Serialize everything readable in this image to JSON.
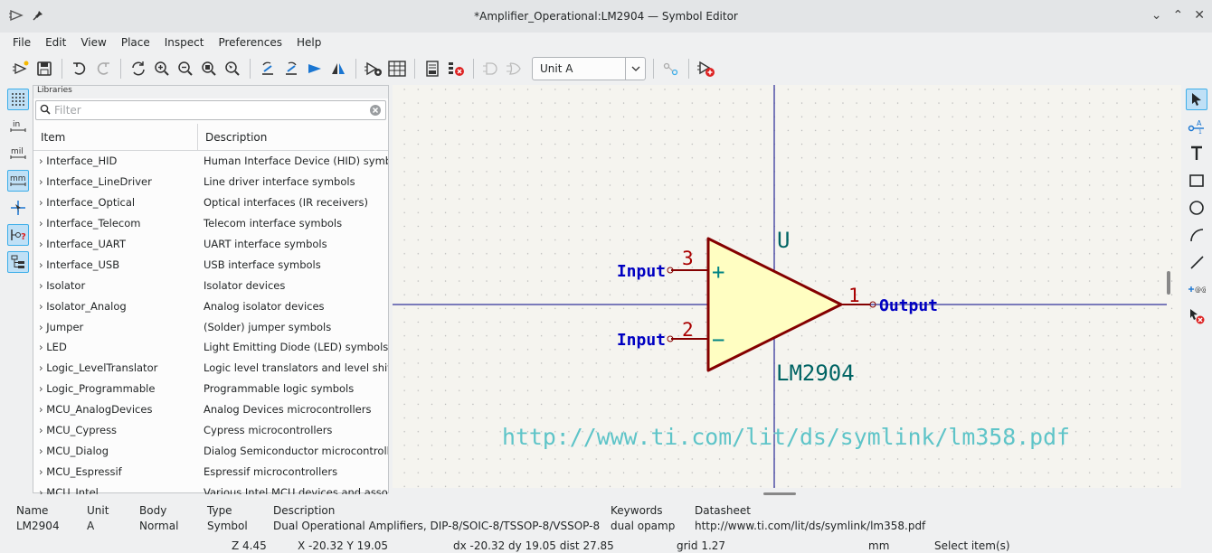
{
  "window": {
    "title": "*Amplifier_Operational:LM2904 — Symbol Editor"
  },
  "menu": [
    "File",
    "Edit",
    "View",
    "Place",
    "Inspect",
    "Preferences",
    "Help"
  ],
  "toolbar": {
    "unit_selected": "Unit A",
    "icons": [
      "new-symbol-icon",
      "save-icon",
      "undo-icon",
      "redo-icon",
      "refresh-icon",
      "zoom-in-icon",
      "zoom-out-icon",
      "zoom-fit-icon",
      "zoom-selection-icon",
      "rotate-ccw-icon",
      "rotate-cw-icon",
      "mirror-v-icon",
      "mirror-h-icon",
      "symbol-properties-icon",
      "pin-table-icon",
      "datasheet-icon",
      "check-icon",
      "de-morgan-standard-icon",
      "de-morgan-alternate-icon",
      "sync-pins-icon",
      "add-to-schematic-icon"
    ]
  },
  "left_tools": [
    "grid-icon",
    "inches-icon",
    "mils-icon",
    "millimeters-icon",
    "cursor-icon",
    "pin-type-icon",
    "hierarchy-icon"
  ],
  "libraries": {
    "panel_title": "Libraries",
    "search_placeholder": "Filter",
    "col_item": "Item",
    "col_description": "Description",
    "rows": [
      {
        "item": "Interface_HID",
        "desc": "Human Interface Device (HID) symbols"
      },
      {
        "item": "Interface_LineDriver",
        "desc": "Line driver interface symbols"
      },
      {
        "item": "Interface_Optical",
        "desc": "Optical interfaces (IR receivers)"
      },
      {
        "item": "Interface_Telecom",
        "desc": "Telecom interface symbols"
      },
      {
        "item": "Interface_UART",
        "desc": "UART interface symbols"
      },
      {
        "item": "Interface_USB",
        "desc": "USB interface symbols"
      },
      {
        "item": "Isolator",
        "desc": "Isolator devices"
      },
      {
        "item": "Isolator_Analog",
        "desc": "Analog isolator devices"
      },
      {
        "item": "Jumper",
        "desc": "(Solder) jumper symbols"
      },
      {
        "item": "LED",
        "desc": "Light Emitting Diode (LED) symbols"
      },
      {
        "item": "Logic_LevelTranslator",
        "desc": "Logic level translators and level shifters"
      },
      {
        "item": "Logic_Programmable",
        "desc": "Programmable logic symbols"
      },
      {
        "item": "MCU_AnalogDevices",
        "desc": "Analog Devices microcontrollers"
      },
      {
        "item": "MCU_Cypress",
        "desc": "Cypress microcontrollers"
      },
      {
        "item": "MCU_Dialog",
        "desc": "Dialog Semiconductor microcontrollers"
      },
      {
        "item": "MCU_Espressif",
        "desc": "Espressif microcontrollers"
      },
      {
        "item": "MCU_Intel",
        "desc": "Various Intel MCU devices and associated"
      }
    ]
  },
  "symbol": {
    "reference": "U",
    "value": "LM2904",
    "datasheet_url": "http://www.ti.com/lit/ds/symlink/lm358.pdf",
    "pins": [
      {
        "number": "3",
        "name": "Input",
        "sign": "+"
      },
      {
        "number": "2",
        "name": "Input",
        "sign": "−"
      },
      {
        "number": "1",
        "name": "Output",
        "sign": ""
      }
    ]
  },
  "right_tools": [
    "select-icon",
    "pin-icon",
    "text-icon",
    "rectangle-icon",
    "circle-icon",
    "arc-icon",
    "line-icon",
    "anchor-icon",
    "delete-icon"
  ],
  "info_panel": {
    "headers": {
      "name": "Name",
      "unit": "Unit",
      "body": "Body",
      "type": "Type",
      "description": "Description",
      "keywords": "Keywords",
      "datasheet": "Datasheet"
    },
    "values": {
      "name": "LM2904",
      "unit": "A",
      "body": "Normal",
      "type": "Symbol",
      "description": "Dual Operational Amplifiers, DIP-8/SOIC-8/TSSOP-8/VSSOP-8",
      "keywords": "dual opamp",
      "datasheet": "http://www.ti.com/lit/ds/symlink/lm358.pdf"
    }
  },
  "status": {
    "zoom": "Z 4.45",
    "cursor": "X -20.32  Y 19.05",
    "delta": "dx -20.32  dy 19.05  dist 27.85",
    "grid": "grid 1.27",
    "units": "mm",
    "message": "Select item(s)"
  },
  "colors": {
    "canvas_bg": "#f5f4ef",
    "symbol_body": "#fffec2",
    "outline": "#840000",
    "pin_number": "#a90000",
    "pin_name": "#0000c2",
    "field_text": "#006464",
    "datasheet_text": "#5ec4c8",
    "axis": "#000084"
  }
}
